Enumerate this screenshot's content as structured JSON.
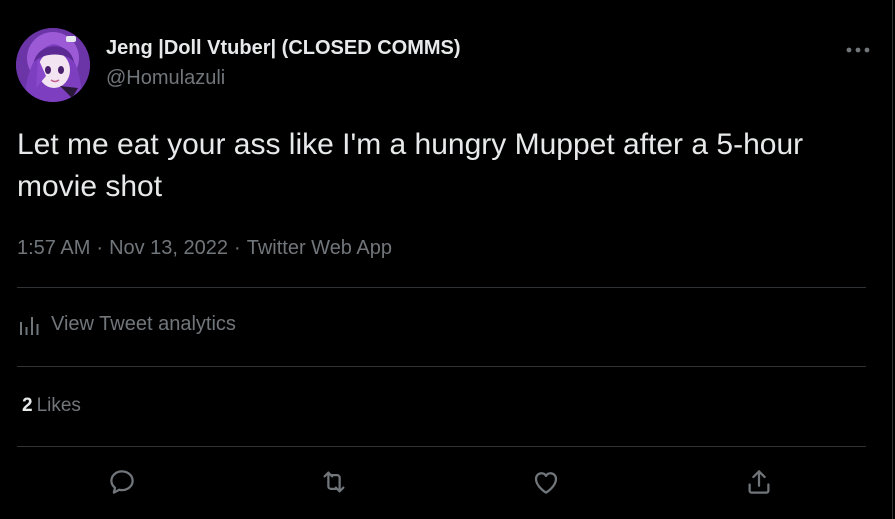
{
  "tweet": {
    "author": {
      "display_name": "Jeng |Doll Vtuber| (CLOSED COMMS)",
      "handle": "@Homulazuli",
      "avatar_icon": "anime-avatar"
    },
    "more_icon": "more-horizontal-icon",
    "text": "Let me eat your ass like I'm a hungry Muppet after a 5-hour movie shot",
    "time": "1:57 AM",
    "date": "Nov 13, 2022",
    "source": "Twitter Web App",
    "separator": "·",
    "analytics_label": "View Tweet analytics",
    "likes": {
      "count": "2",
      "label": "Likes"
    },
    "actions": [
      {
        "name": "reply",
        "icon": "reply-icon"
      },
      {
        "name": "retweet",
        "icon": "retweet-icon"
      },
      {
        "name": "like",
        "icon": "heart-icon"
      },
      {
        "name": "share",
        "icon": "share-icon"
      }
    ]
  },
  "colors": {
    "background": "#000000",
    "primary_text": "#e7e9ea",
    "secondary_text": "#71767b",
    "divider": "#2f3336"
  }
}
